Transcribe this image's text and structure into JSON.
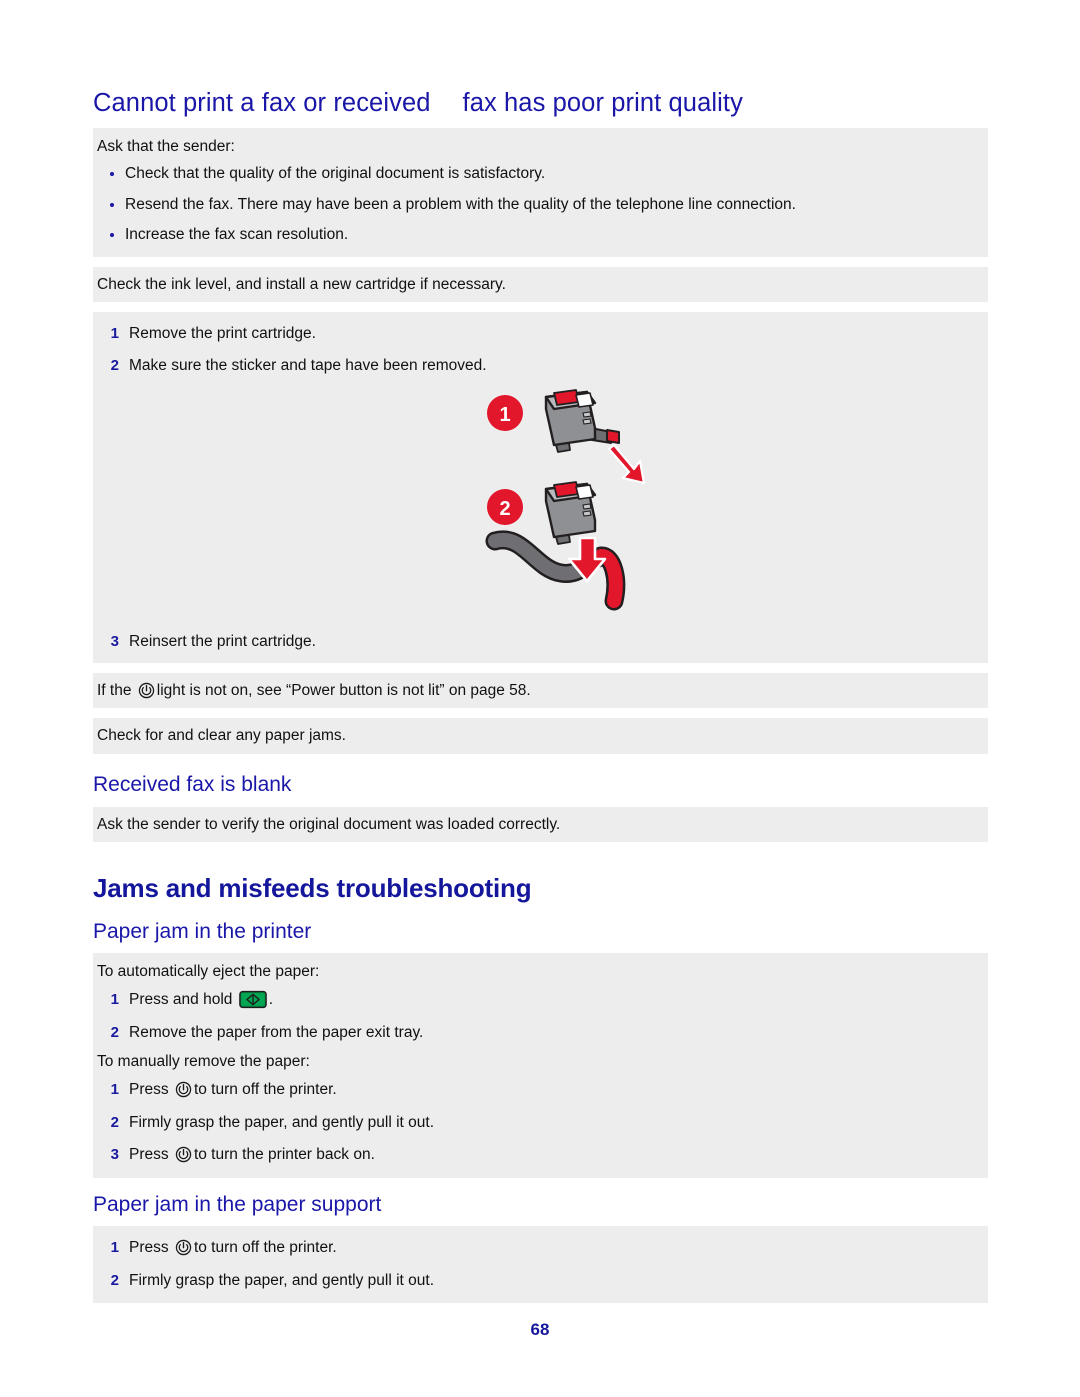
{
  "page": {
    "number": "68",
    "colors": {
      "heading_blue": "#1a17a8",
      "band_gray": "#ededed",
      "callout_red": "#e2172b",
      "button_green": "#009949",
      "step_number_blue": "#1a1aa0"
    }
  },
  "section_fax": {
    "title_part1": "Cannot print a fax or received",
    "title_part2": "fax has poor print quality",
    "ask_sender_intro": "Ask that the sender:",
    "ask_sender_bullets": [
      "Check that the quality of the original document is satisfactory.",
      "Resend the fax. There may have been a problem with the quality of the telephone line connection.",
      "Increase the fax scan resolution."
    ],
    "ink_level_para": "Check the ink level, and install a new cartridge if necessary.",
    "cartridge_steps": [
      {
        "num": "1",
        "text": "Remove the print cartridge."
      },
      {
        "num": "2",
        "text": "Make sure the sticker and tape have been removed."
      }
    ],
    "illustration": {
      "callout_1": "1",
      "callout_2": "2",
      "name": "print-cartridge-tape-removal-illustration"
    },
    "reinsert_step": {
      "num": "3",
      "text": "Reinsert the print cartridge."
    },
    "power_light_text_before": "If the",
    "power_light_text_after": "light is not on, see “Power button is not lit” on page 58.",
    "paper_jams_para": "Check for and clear any paper jams."
  },
  "section_blank_fax": {
    "heading": "Received fax is blank",
    "para": "Ask the sender to verify the original document was loaded correctly."
  },
  "section_jams": {
    "heading": "Jams and misfeeds troubleshooting",
    "printer_jam": {
      "heading": "Paper jam in the printer",
      "auto_intro": "To automatically eject the paper:",
      "auto_steps": [
        {
          "num": "1",
          "text_before": "Press and hold",
          "icon": "paper-feed-button-icon",
          "text_after": "."
        },
        {
          "num": "2",
          "text_before": "Remove the paper from the paper exit tray.",
          "icon": "",
          "text_after": ""
        }
      ],
      "manual_intro": "To manually remove the paper:",
      "manual_steps": [
        {
          "num": "1",
          "text_before": "Press",
          "icon": "power-button-icon",
          "text_after": "to turn off the printer."
        },
        {
          "num": "2",
          "text_before": "Firmly grasp the paper, and gently pull it out.",
          "icon": "",
          "text_after": ""
        },
        {
          "num": "3",
          "text_before": "Press",
          "icon": "power-button-icon",
          "text_after": "to turn the printer back on."
        }
      ]
    },
    "support_jam": {
      "heading": "Paper jam in the paper support",
      "steps": [
        {
          "num": "1",
          "text_before": "Press",
          "icon": "power-button-icon",
          "text_after": "to turn off the printer."
        },
        {
          "num": "2",
          "text_before": "Firmly grasp the paper, and gently pull it out.",
          "icon": "",
          "text_after": ""
        }
      ]
    }
  }
}
